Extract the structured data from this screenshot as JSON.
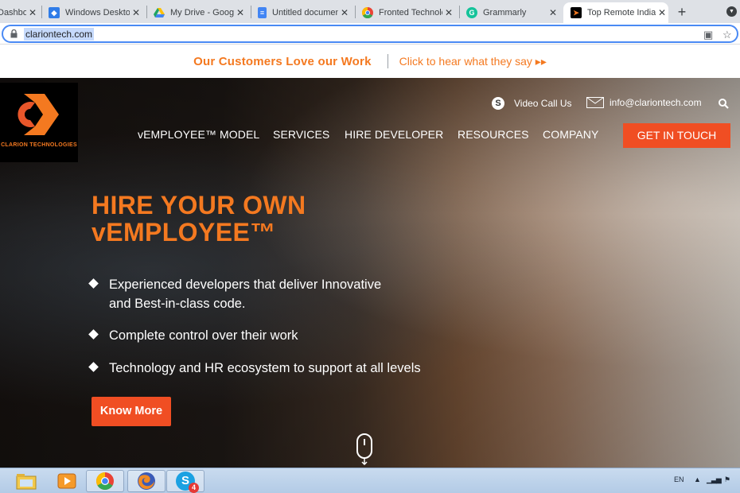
{
  "browser": {
    "tabs": [
      {
        "title": "Dashboard",
        "favicon": "dashboard-icon",
        "color": "#5f6368",
        "active": false
      },
      {
        "title": "Windows Desktop",
        "favicon": "azure-devops-icon",
        "color": "#2f7ce8",
        "active": false
      },
      {
        "title": "My Drive - Google",
        "favicon": "google-drive-icon",
        "color": "#1fa463",
        "active": false
      },
      {
        "title": "Untitled document",
        "favicon": "google-docs-icon",
        "color": "#4285f4",
        "active": false
      },
      {
        "title": "Fronted Technolog",
        "favicon": "chrome-favicon-icon",
        "color": "#ea4335",
        "active": false
      },
      {
        "title": "Grammarly",
        "favicon": "grammarly-icon",
        "color": "#15c39a",
        "active": false
      },
      {
        "title": "Top Remote India",
        "favicon": "clarion-favicon-icon",
        "color": "#000000",
        "active": true
      }
    ],
    "url": "clariontech.com"
  },
  "banner": {
    "headline": "Our Customers Love our Work",
    "link": "Click to hear what they say ▸▸"
  },
  "site": {
    "logo_text": "CLARION TECHNOLOGIES",
    "video_call": "Video Call Us",
    "email": "info@clariontech.com",
    "nav": [
      "vEMPLOYEE™ MODEL",
      "SERVICES",
      "HIRE DEVELOPER",
      "RESOURCES",
      "COMPANY"
    ],
    "cta": "GET IN TOUCH"
  },
  "hero": {
    "headline_line1": "HIRE YOUR OWN",
    "headline_line2": "vEMPLOYEE™",
    "bullets": [
      {
        "line1": "Experienced developers that deliver Innovative",
        "line2": "and Best-in-class code."
      },
      {
        "line1": "Complete control over their work",
        "line2": ""
      },
      {
        "line1": "Technology and HR ecosystem to support at all levels",
        "line2": ""
      }
    ],
    "button": "Know More"
  },
  "taskbar": {
    "apps": [
      "windows-explorer-icon",
      "media-player-icon",
      "chrome-icon",
      "firefox-icon",
      "skype-icon"
    ],
    "skype_badge": "4",
    "language": "EN"
  },
  "colors": {
    "brand_orange": "#f47920",
    "cta_red": "#f04e23"
  }
}
